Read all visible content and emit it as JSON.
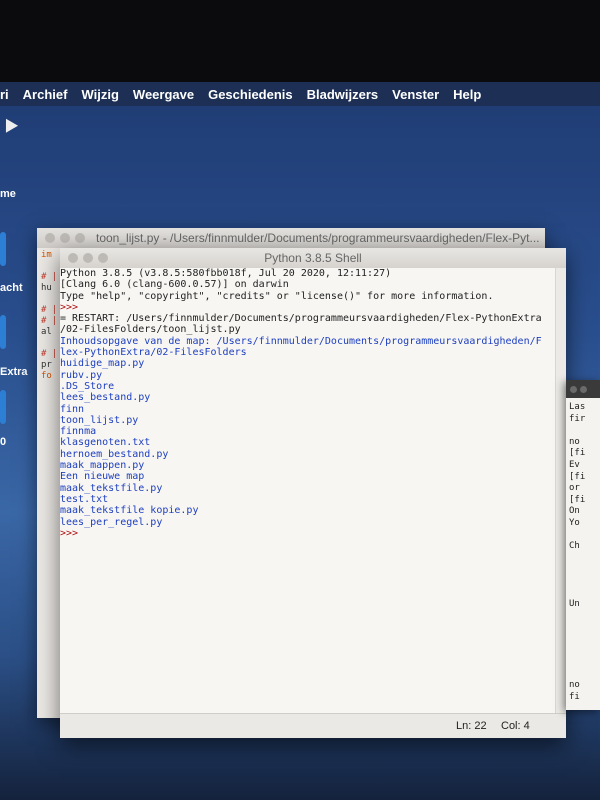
{
  "menubar": {
    "items": [
      "ri",
      "Archief",
      "Wijzig",
      "Weergave",
      "Geschiedenis",
      "Bladwijzers",
      "Venster",
      "Help"
    ]
  },
  "desktop": {
    "side_labels": [
      "me",
      "acht",
      "Extra",
      "0"
    ]
  },
  "back_window": {
    "title": "toon_lijst.py - /Users/finnmulder/Documents/programmeursvaardigheden/Flex-Pyt...",
    "code_lines": [
      "im",
      "",
      "# |",
      "hu",
      "",
      "# |",
      "# |",
      "al",
      "",
      "# |",
      "pr",
      "fo"
    ]
  },
  "shell": {
    "title": "Python 3.8.5 Shell",
    "lines": [
      {
        "text": "Python 3.8.5 (v3.8.5:580fbb018f, Jul 20 2020, 12:11:27)",
        "style": "out"
      },
      {
        "text": "[Clang 6.0 (clang-600.0.57)] on darwin",
        "style": "out"
      },
      {
        "text": "Type \"help\", \"copyright\", \"credits\" or \"license()\" for more information.",
        "style": "out"
      },
      {
        "text": ">>>",
        "style": "prompt"
      },
      {
        "text": "= RESTART: /Users/finnmulder/Documents/programmeursvaardigheden/Flex-PythonExtra",
        "style": "out"
      },
      {
        "text": "/02-FilesFolders/toon_lijst.py",
        "style": "out"
      },
      {
        "text": "Inhoudsopgave van de map: /Users/finnmulder/Documents/programmeursvaardigheden/F",
        "style": "blue"
      },
      {
        "text": "lex-PythonExtra/02-FilesFolders",
        "style": "blue"
      },
      {
        "text": "huidige_map.py",
        "style": "blue"
      },
      {
        "text": "rubv.py",
        "style": "blue"
      },
      {
        "text": ".DS_Store",
        "style": "blue"
      },
      {
        "text": "lees_bestand.py",
        "style": "blue"
      },
      {
        "text": "finn",
        "style": "blue"
      },
      {
        "text": "toon_lijst.py",
        "style": "blue"
      },
      {
        "text": "finnma",
        "style": "blue"
      },
      {
        "text": "klasgenoten.txt",
        "style": "blue"
      },
      {
        "text": "hernoem_bestand.py",
        "style": "blue"
      },
      {
        "text": "maak_mappen.py",
        "style": "blue"
      },
      {
        "text": "Een nieuwe map",
        "style": "blue"
      },
      {
        "text": "maak_tekstfile.py",
        "style": "blue"
      },
      {
        "text": "test.txt",
        "style": "blue"
      },
      {
        "text": "maak_tekstfile kopie.py",
        "style": "blue"
      },
      {
        "text": "lees_per_regel.py",
        "style": "blue"
      },
      {
        "text": ">>>",
        "style": "prompt"
      }
    ],
    "status": {
      "line": "Ln: 22",
      "col": "Col: 4"
    }
  },
  "right_window": {
    "lines": [
      "Las",
      "fir",
      "",
      "no",
      "[fi",
      "Ev",
      "[fi",
      "or",
      "[fi",
      "On",
      "Yo",
      "",
      "Ch",
      "",
      "",
      "",
      "",
      "Un",
      "",
      "",
      "",
      "",
      "",
      "",
      "no",
      "fi"
    ]
  }
}
